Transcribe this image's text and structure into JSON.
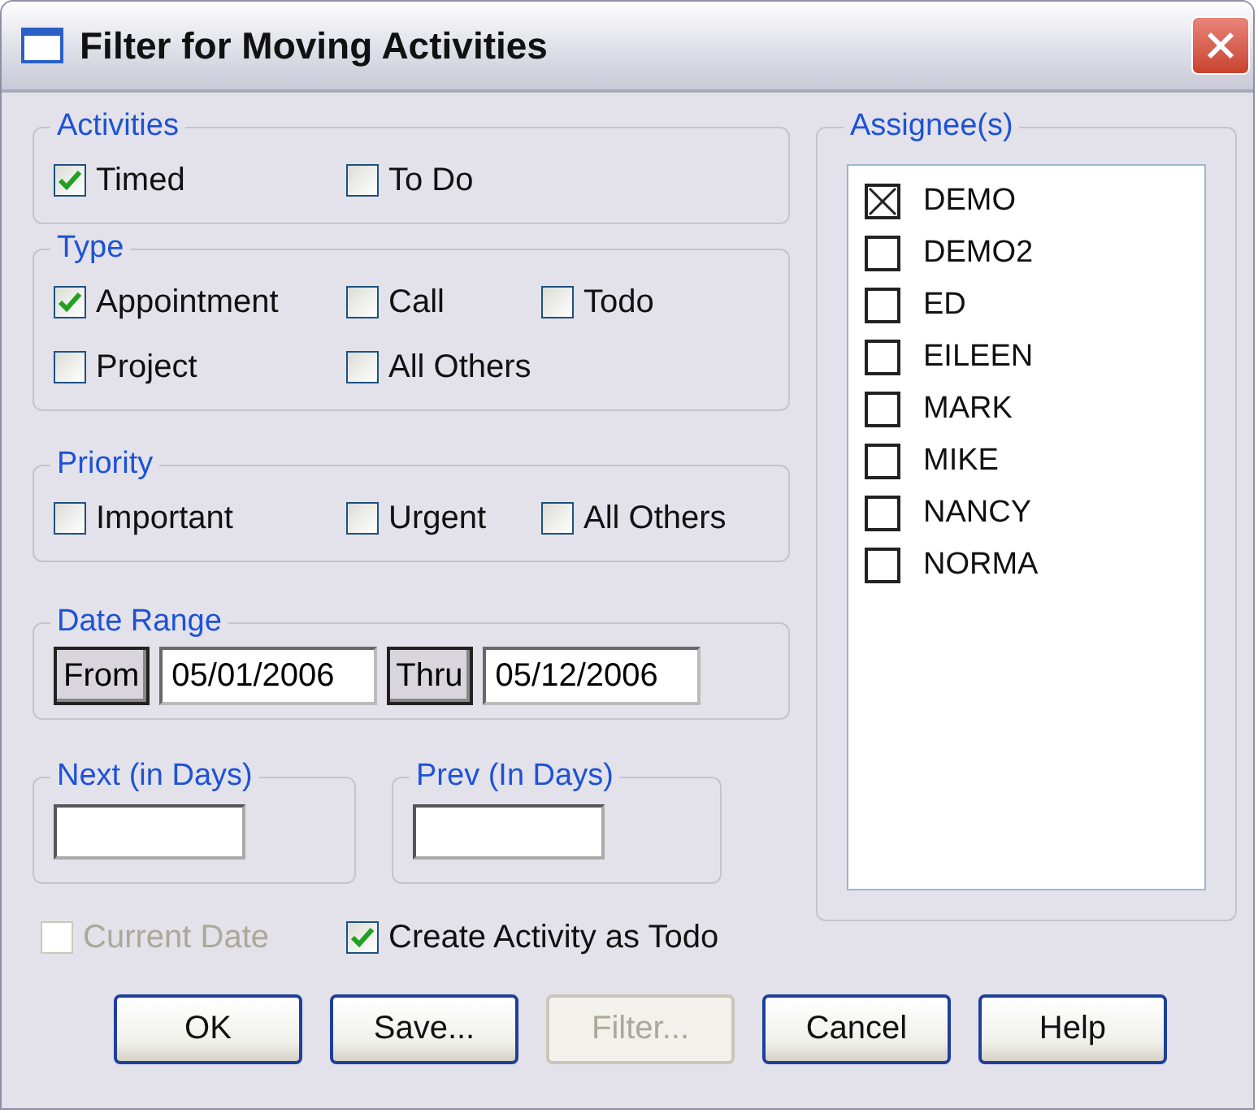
{
  "window": {
    "title": "Filter for Moving Activities"
  },
  "groups": [
    {
      "title": "Activities",
      "rows": [
        [
          {
            "label": "Timed",
            "checked": true
          },
          {
            "label": "To Do",
            "checked": false
          }
        ]
      ]
    },
    {
      "title": "Type",
      "rows": [
        [
          {
            "label": "Appointment",
            "checked": true
          },
          {
            "label": "Call",
            "checked": false
          },
          {
            "label": "Todo",
            "checked": false
          }
        ],
        [
          {
            "label": "Project",
            "checked": false
          },
          {
            "label": "All Others",
            "checked": false
          }
        ]
      ]
    },
    {
      "title": "Priority",
      "rows": [
        [
          {
            "label": "Important",
            "checked": false
          },
          {
            "label": "Urgent",
            "checked": false
          },
          {
            "label": "All Others",
            "checked": false
          }
        ]
      ]
    }
  ],
  "date_range": {
    "title": "Date Range",
    "from_button": "From",
    "from_value": "05/01/2006",
    "thru_button": "Thru",
    "thru_value": "05/12/2006"
  },
  "day_fields": [
    {
      "title": "Next (in Days)"
    },
    {
      "title": "Prev (In Days)"
    }
  ],
  "bottom_options": [
    {
      "label": "Current Date",
      "checked": false,
      "disabled": true
    },
    {
      "label": "Create Activity as Todo",
      "checked": true,
      "disabled": false
    }
  ],
  "assignees": {
    "title": "Assignee(s)",
    "items": [
      {
        "name": "DEMO",
        "checked": true
      },
      {
        "name": "DEMO2",
        "checked": false
      },
      {
        "name": "ED",
        "checked": false
      },
      {
        "name": "EILEEN",
        "checked": false
      },
      {
        "name": "MARK",
        "checked": false
      },
      {
        "name": "MIKE",
        "checked": false
      },
      {
        "name": "NANCY",
        "checked": false
      },
      {
        "name": "NORMA",
        "checked": false
      }
    ]
  },
  "buttons": [
    {
      "label": "OK",
      "disabled": false
    },
    {
      "label": "Save...",
      "disabled": false
    },
    {
      "label": "Filter...",
      "disabled": true
    },
    {
      "label": "Cancel",
      "disabled": false
    },
    {
      "label": "Help",
      "disabled": false
    }
  ]
}
